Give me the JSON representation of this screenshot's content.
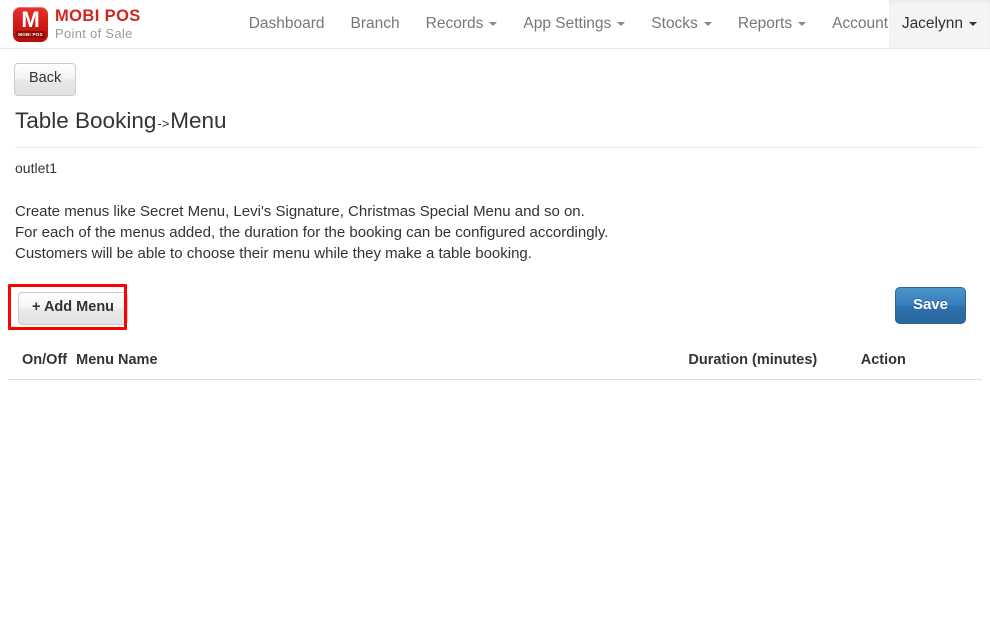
{
  "navbar": {
    "brand": {
      "mark_letter": "M",
      "mark_sub": "MOBI POS",
      "title": "MOBI POS",
      "subtitle": "Point of Sale"
    },
    "items": [
      {
        "label": "Dashboard",
        "caret": false,
        "active": false
      },
      {
        "label": "Branch",
        "caret": false,
        "active": false
      },
      {
        "label": "Records",
        "caret": true,
        "active": false
      },
      {
        "label": "App Settings",
        "caret": true,
        "active": false
      },
      {
        "label": "Stocks",
        "caret": true,
        "active": false
      },
      {
        "label": "Reports",
        "caret": true,
        "active": false
      },
      {
        "label": "Accounts",
        "caret": true,
        "active": false
      }
    ],
    "user": {
      "label": "Jacelynn",
      "caret": true,
      "active": true
    }
  },
  "toolbar": {
    "back_label": "Back"
  },
  "page": {
    "title_main": "Table Booking",
    "title_arrow": "->",
    "title_sub": "Menu",
    "outlet": "outlet1",
    "description_lines": [
      "Create menus like Secret Menu, Levi's Signature, Christmas Special Menu and so on.",
      "For each of the menus added, the duration for the booking can be configured accordingly.",
      "Customers will be able to choose their menu while they make a table booking."
    ]
  },
  "actions": {
    "add_menu_label": "+ Add Menu",
    "save_label": "Save",
    "highlight_color": "#ff0000",
    "save_color": "#357ebd"
  },
  "table": {
    "headers": {
      "onoff": "On/Off",
      "menu_name": "Menu Name",
      "duration": "Duration (minutes)",
      "action": "Action"
    },
    "rows": []
  }
}
